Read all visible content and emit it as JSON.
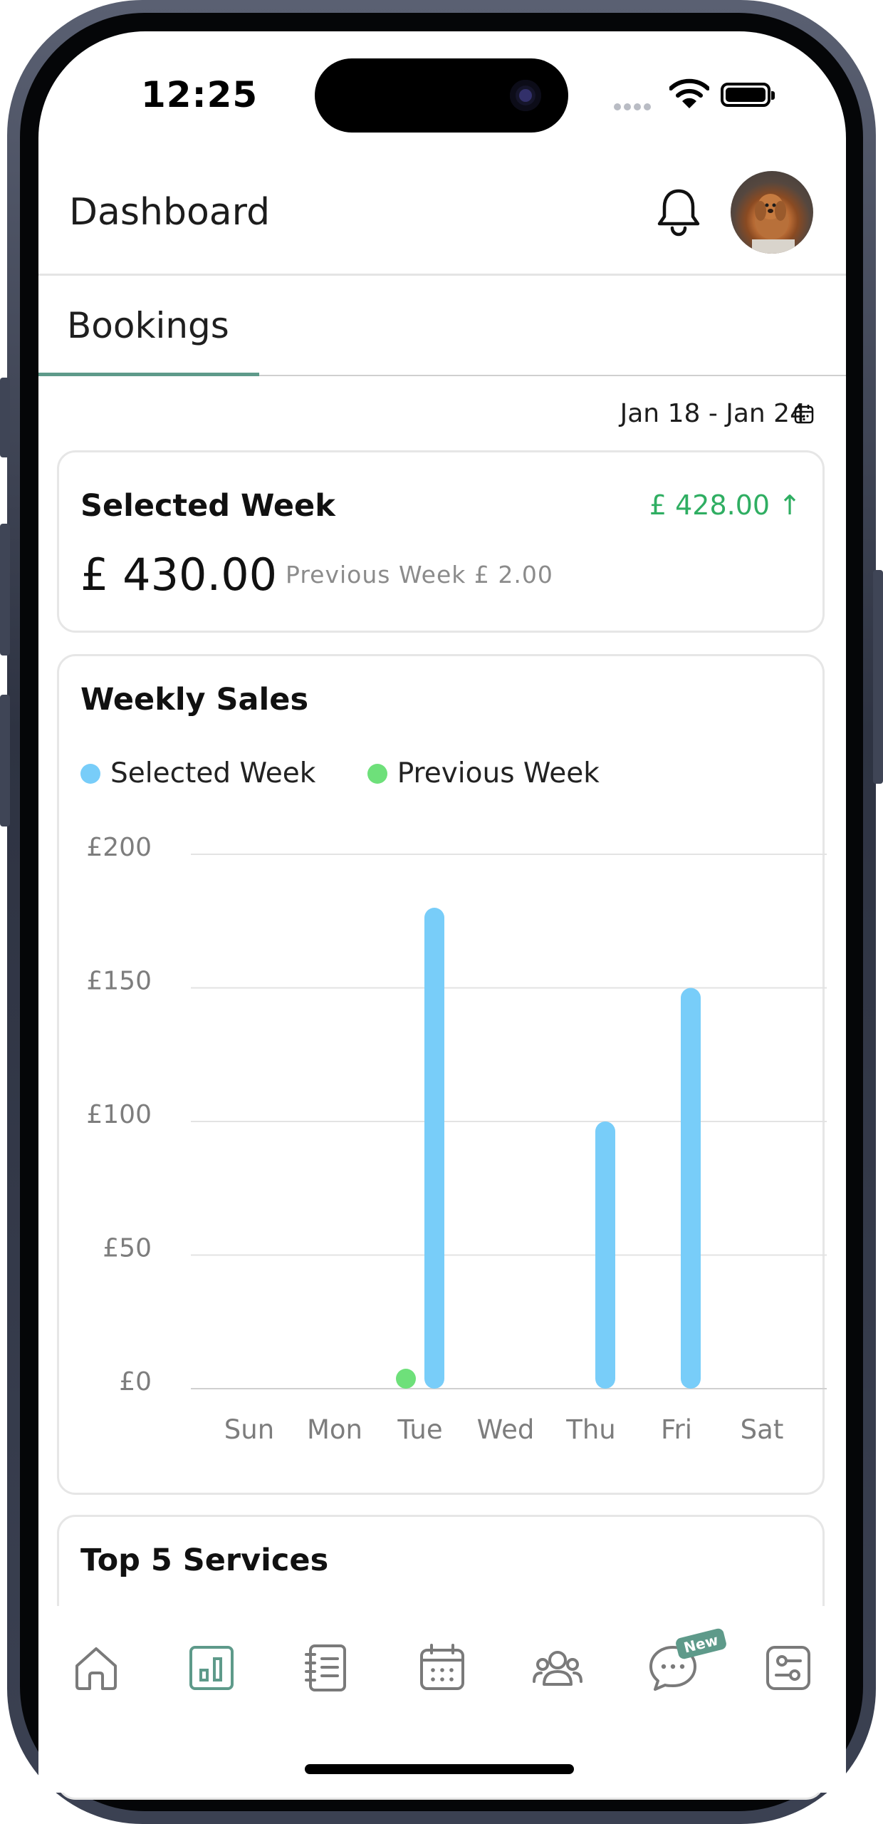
{
  "status": {
    "time": "12:25"
  },
  "header": {
    "title": "Dashboard"
  },
  "tabs": [
    {
      "label": "Bookings",
      "active": true
    }
  ],
  "date_range": "Jan 18 - Jan 24",
  "selected_week_card": {
    "title": "Selected Week",
    "amount": "£ 430.00",
    "change": "£ 428.00 ↑",
    "previous": "Previous Week £ 2.00",
    "change_color": "#2fae62"
  },
  "weekly_sales_card": {
    "title": "Weekly Sales",
    "legend": [
      {
        "label": "Selected Week",
        "color": "#78cdf9"
      },
      {
        "label": "Previous Week",
        "color": "#6ee07a"
      }
    ]
  },
  "chart_data": {
    "type": "bar",
    "categories": [
      "Sun",
      "Mon",
      "Tue",
      "Wed",
      "Thu",
      "Fri",
      "Sat"
    ],
    "y_ticks": [
      "£200",
      "£150",
      "£100",
      "£50",
      "£0"
    ],
    "ylim": [
      0,
      200
    ],
    "series": [
      {
        "name": "Selected Week",
        "color": "#78cdf9",
        "values": [
          0,
          0,
          180,
          0,
          100,
          150,
          0
        ]
      },
      {
        "name": "Previous Week",
        "color": "#6ee07a",
        "values": [
          0,
          0,
          2,
          0,
          0,
          0,
          0
        ]
      }
    ],
    "grid": true
  },
  "top_services_card": {
    "title": "Top 5 Services"
  },
  "bottom_nav": {
    "items": [
      {
        "icon": "home-icon"
      },
      {
        "icon": "chart-icon",
        "active": true
      },
      {
        "icon": "notebook-icon"
      },
      {
        "icon": "calendar-icon"
      },
      {
        "icon": "users-icon"
      },
      {
        "icon": "chat-icon",
        "badge": "New"
      },
      {
        "icon": "settings-icon"
      }
    ],
    "active_color": "#5e9a8a",
    "inactive_color": "#7a7a7a"
  }
}
